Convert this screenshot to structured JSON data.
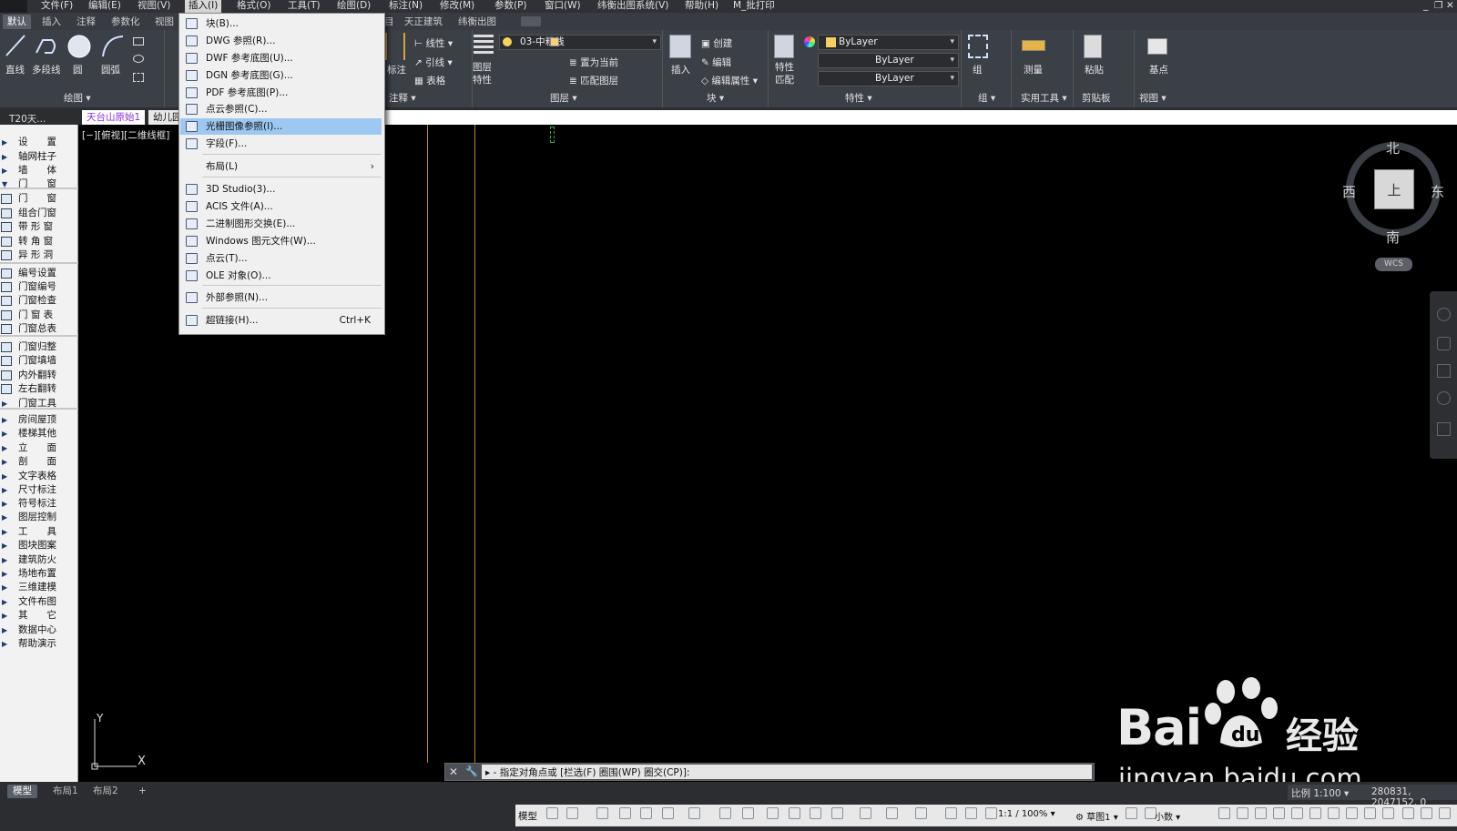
{
  "menubar": {
    "items": [
      "文件(F)",
      "编辑(E)",
      "视图(V)",
      "插入(I)",
      "格式(O)",
      "工具(T)",
      "绘图(D)",
      "标注(N)",
      "修改(M)",
      "参数(P)",
      "窗口(W)",
      "纬衡出图系统(V)",
      "帮助(H)",
      "M_批打印"
    ],
    "window_controls": [
      "_",
      "❐",
      "✕"
    ]
  },
  "ribbon_tabs": {
    "items": [
      "默认",
      "插入",
      "注释",
      "参数化",
      "视图",
      "目",
      "天正建筑",
      "纬衡出图"
    ],
    "active": "默认"
  },
  "ribbon": {
    "draw": {
      "line": "直线",
      "polyline": "多段线",
      "circle": "圆",
      "arc": "圆弧",
      "group_label": "绘图"
    },
    "annotate": {
      "linear": "线性",
      "leader": "引线",
      "table": "表格",
      "dim": "标注",
      "group_label": "注释"
    },
    "layers": {
      "props": "图层\n特性",
      "current_layer": "03-中粗线",
      "set_current": "置为当前",
      "match_layer": "匹配图层",
      "group_label": "图层"
    },
    "block": {
      "insert": "插入",
      "create": "创建",
      "edit": "编辑",
      "edit_attr": "编辑属性",
      "group_label": "块"
    },
    "properties": {
      "match": "特性\n匹配",
      "color": "ByLayer",
      "linetype": "ByLayer",
      "lineweight": "ByLayer",
      "group_label": "特性"
    },
    "groups": {
      "group": "组",
      "group_label": "组"
    },
    "utilities": {
      "measure": "测量",
      "group_label": "实用工具"
    },
    "clipboard": {
      "paste": "粘贴",
      "group_label": "剪贴板"
    },
    "view": {
      "base": "基点",
      "group_label": "视图"
    }
  },
  "doc_tabs": {
    "panel_title": "T20天...",
    "tabs": [
      "天台山原始1",
      "幼儿园"
    ],
    "viewport_label": "[−][俯视][二维线框]"
  },
  "insert_menu": {
    "items": [
      {
        "label": "块(B)..."
      },
      {
        "label": "DWG 参照(R)..."
      },
      {
        "label": "DWF 参考底图(U)..."
      },
      {
        "label": "DGN 参考底图(G)..."
      },
      {
        "label": "PDF 参考底图(P)..."
      },
      {
        "label": "点云参照(C)..."
      },
      {
        "label": "光栅图像参照(I)..."
      },
      {
        "label": "字段(F)..."
      },
      {
        "label": "布局(L)",
        "submenu": "›"
      },
      {
        "label": "3D Studio(3)..."
      },
      {
        "label": "ACIS 文件(A)..."
      },
      {
        "label": "二进制图形交换(E)..."
      },
      {
        "label": "Windows 图元文件(W)..."
      },
      {
        "label": "点云(T)..."
      },
      {
        "label": "OLE 对象(O)..."
      },
      {
        "label": "外部参照(N)..."
      },
      {
        "label": "超链接(H)...",
        "shortcut": "Ctrl+K"
      }
    ],
    "highlighted": "光栅图像参照(I)..."
  },
  "sidebar": {
    "items": [
      "设　　置",
      "轴网柱子",
      "墙　　体",
      "门　　窗",
      "门　　窗",
      "组合门窗",
      "带 形 窗",
      "转 角 窗",
      "异 形 洞",
      "编号设置",
      "门窗编号",
      "门窗检查",
      "门 窗 表",
      "门窗总表",
      "门窗归整",
      "门窗填墙",
      "内外翻转",
      "左右翻转",
      "门窗工具",
      "房间屋顶",
      "楼梯其他",
      "立　　面",
      "剖　　面",
      "文字表格",
      "尺寸标注",
      "符号标注",
      "图层控制",
      "工　　具",
      "图块图案",
      "建筑防火",
      "场地布置",
      "三维建模",
      "文件布图",
      "其　　它",
      "数据中心",
      "帮助演示"
    ]
  },
  "viewcube": {
    "north": "北",
    "south": "南",
    "east": "东",
    "west": "西",
    "face": "上",
    "wcs": "WCS"
  },
  "ucs": {
    "x": "X",
    "y": "Y"
  },
  "command": {
    "prompt": "指定对角点或 [栏选(F) 圈围(WP) 圈交(CP)]:"
  },
  "layout_tabs": {
    "items": [
      "模型",
      "布局1",
      "布局2"
    ],
    "add": "+"
  },
  "status": {
    "scale_label": "比例 1:100",
    "coords": "280831, 2047152, 0",
    "model": "模型",
    "anno_scale": "1:1 / 100%",
    "workspace": "草图1",
    "units": "小数"
  },
  "watermark": {
    "logo": "Bai",
    "brand": "经验",
    "url": "jingyan.baidu.com"
  },
  "colors": {
    "accent": "#9cc8f2",
    "canvas": "#000000",
    "ribbon": "#3b3f46",
    "guide_line": "#b8860b"
  }
}
